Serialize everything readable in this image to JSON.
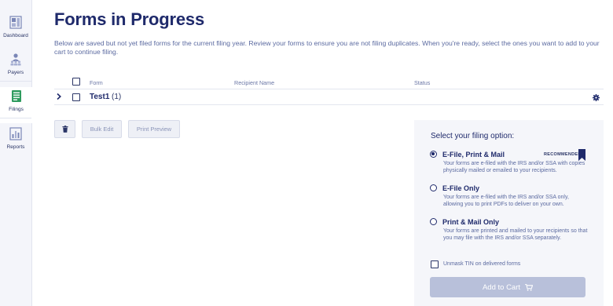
{
  "sidebar": {
    "items": [
      {
        "label": "Dashboard",
        "icon": "dashboard-icon",
        "active": false
      },
      {
        "label": "Payers",
        "icon": "payers-icon",
        "active": false
      },
      {
        "label": "Filings",
        "icon": "filings-icon",
        "active": true
      },
      {
        "label": "Reports",
        "icon": "reports-icon",
        "active": false
      }
    ]
  },
  "page": {
    "title": "Forms in Progress",
    "intro": "Below are saved but not yet filed forms for the current filing year. Review your forms to ensure you are not filing duplicates. When you're ready, select the ones you want to add to your cart to continue filing."
  },
  "table": {
    "columns": [
      "Form",
      "Recipient Name",
      "Status"
    ],
    "rows": [
      {
        "name": "Test1",
        "count": "(1)"
      }
    ]
  },
  "actions": {
    "bulk_edit": "Bulk Edit",
    "print_preview": "Print Preview"
  },
  "filing": {
    "title": "Select your filing option:",
    "options": [
      {
        "title": "E-File, Print & Mail",
        "desc": "Your forms are e-filed with the IRS and/or SSA with copies physically mailed or emailed to your recipients.",
        "badge": "RECOMMENDED",
        "selected": true
      },
      {
        "title": "E-File Only",
        "desc": "Your forms are e-filed with the IRS and/or SSA only, allowing you to print PDFs to deliver on your own.",
        "selected": false
      },
      {
        "title": "Print & Mail Only",
        "desc": "Your forms are printed and mailed to your recipients so that you may file with the IRS and/or SSA separately.",
        "selected": false
      }
    ],
    "unmask": "Unmask TIN on delivered forms",
    "add_to_cart": "Add to Cart"
  },
  "colors": {
    "navy": "#1f2a6b",
    "muted": "#5b6aa0",
    "filings_accent": "#2e9b5e",
    "disabled_button": "#b8c0da"
  }
}
